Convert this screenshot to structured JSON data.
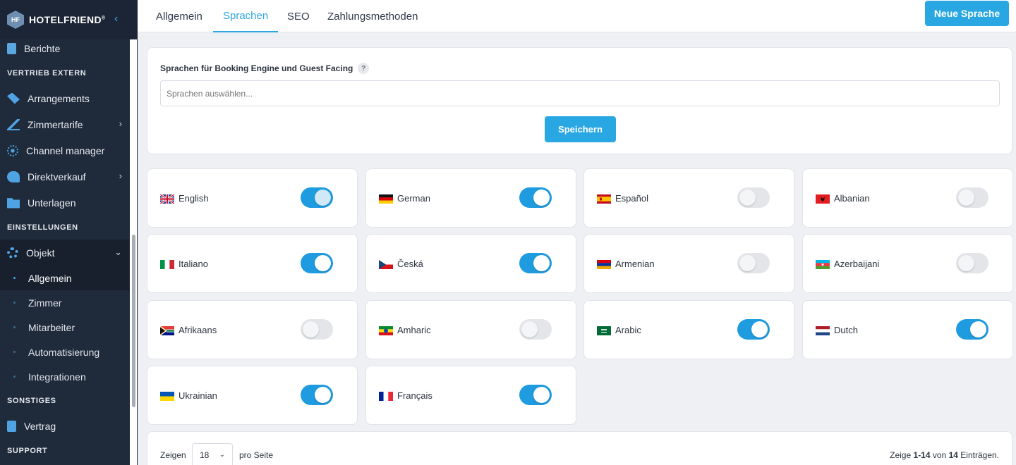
{
  "brand": {
    "name": "HOTELFRIEND",
    "mark": "®",
    "logo_text": "HF"
  },
  "sidebar": {
    "items": [
      {
        "type": "item",
        "label": "Berichte",
        "icon": "clipboard-icon"
      },
      {
        "type": "section",
        "label": "VERTRIEB EXTERN"
      },
      {
        "type": "item",
        "label": "Arrangements",
        "icon": "tag-icon"
      },
      {
        "type": "item",
        "label": "Zimmertarife",
        "icon": "chart-icon",
        "chevron": "›"
      },
      {
        "type": "item",
        "label": "Channel manager",
        "icon": "network-icon"
      },
      {
        "type": "item",
        "label": "Direktverkauf",
        "icon": "handshake-icon",
        "chevron": "›"
      },
      {
        "type": "item",
        "label": "Unterlagen",
        "icon": "folder-icon"
      },
      {
        "type": "section",
        "label": "EINSTELLUNGEN"
      },
      {
        "type": "item",
        "label": "Objekt",
        "icon": "gear-icon",
        "chevron": "⌄",
        "active": true
      },
      {
        "type": "sub",
        "label": "Allgemein",
        "active": true
      },
      {
        "type": "sub",
        "label": "Zimmer"
      },
      {
        "type": "sub",
        "label": "Mitarbeiter"
      },
      {
        "type": "sub",
        "label": "Automatisierung"
      },
      {
        "type": "sub",
        "label": "Integrationen"
      },
      {
        "type": "section",
        "label": "SONSTIGES"
      },
      {
        "type": "item",
        "label": "Vertrag",
        "icon": "contract-icon"
      },
      {
        "type": "section",
        "label": "SUPPORT"
      }
    ]
  },
  "tabs": [
    {
      "label": "Allgemein"
    },
    {
      "label": "Sprachen",
      "active": true
    },
    {
      "label": "SEO"
    },
    {
      "label": "Zahlungsmethoden"
    }
  ],
  "header": {
    "new_button": "Neue Sprache"
  },
  "booking": {
    "label": "Sprachen für Booking Engine und Guest Facing",
    "help": "?",
    "placeholder": "Sprachen auswählen...",
    "save": "Speichern"
  },
  "languages": [
    {
      "name": "English",
      "on": true,
      "flag": "uk"
    },
    {
      "name": "German",
      "on": true,
      "flag": "de"
    },
    {
      "name": "Español",
      "on": false,
      "flag": "es"
    },
    {
      "name": "Albanian",
      "on": false,
      "flag": "al"
    },
    {
      "name": "Italiano",
      "on": true,
      "flag": "it"
    },
    {
      "name": "Česká",
      "on": true,
      "flag": "cz"
    },
    {
      "name": "Armenian",
      "on": false,
      "flag": "am"
    },
    {
      "name": "Azerbaijani",
      "on": false,
      "flag": "az"
    },
    {
      "name": "Afrikaans",
      "on": false,
      "flag": "za"
    },
    {
      "name": "Amharic",
      "on": false,
      "flag": "et"
    },
    {
      "name": "Arabic",
      "on": true,
      "flag": "sa"
    },
    {
      "name": "Dutch",
      "on": true,
      "flag": "nl"
    },
    {
      "name": "Ukrainian",
      "on": true,
      "flag": "ua"
    },
    {
      "name": "Français",
      "on": true,
      "flag": "fr"
    }
  ],
  "footer": {
    "show": "Zeigen",
    "per_page": "18",
    "per_page_suffix": "pro Seite",
    "range_prefix": "Zeige",
    "range": "1-14",
    "of": "von",
    "total": "14",
    "suffix": "Einträgen."
  },
  "colors": {
    "accent": "#29a7e3",
    "sidebar_bg": "#1f2a3a"
  }
}
